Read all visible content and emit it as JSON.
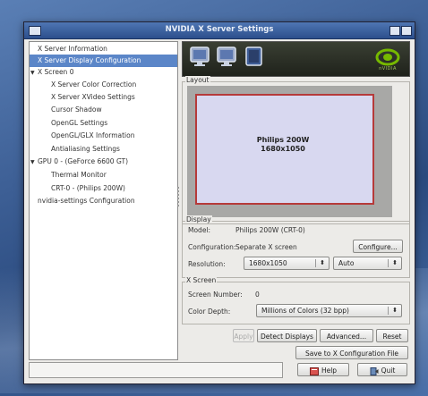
{
  "window": {
    "title": "NVIDIA X Server Settings"
  },
  "sidebar": {
    "items": [
      {
        "label": "X Server Information",
        "level": 1,
        "selected": false
      },
      {
        "label": "X Server Display Configuration",
        "level": 1,
        "selected": true
      },
      {
        "label": "X Screen 0",
        "level": 0,
        "expandable": true
      },
      {
        "label": "X Server Color Correction",
        "level": 2
      },
      {
        "label": "X Server XVideo Settings",
        "level": 2
      },
      {
        "label": "Cursor Shadow",
        "level": 2
      },
      {
        "label": "OpenGL Settings",
        "level": 2
      },
      {
        "label": "OpenGL/GLX Information",
        "level": 2
      },
      {
        "label": "Antialiasing Settings",
        "level": 2
      },
      {
        "label": "GPU 0 - (GeForce 6600 GT)",
        "level": 0,
        "expandable": true
      },
      {
        "label": "Thermal Monitor",
        "level": 2
      },
      {
        "label": "CRT-0 - (Philips 200W)",
        "level": 2
      },
      {
        "label": "nvidia-settings Configuration",
        "level": 1
      }
    ]
  },
  "banner": {
    "logo_text": "nVIDIA",
    "logo_color": "#76b900"
  },
  "layout": {
    "section_label": "Layout",
    "screen_title": "Philips 200W",
    "screen_resolution": "1680x1050"
  },
  "display": {
    "section_label": "Display",
    "model_label": "Model:",
    "model_value": "Philips 200W (CRT-0)",
    "configuration_label": "Configuration:",
    "configuration_value": "Separate X screen",
    "configure_button": "Configure...",
    "resolution_label": "Resolution:",
    "resolution_value": "1680x1050",
    "refresh_value": "Auto"
  },
  "xscreen": {
    "section_label": "X Screen",
    "screen_number_label": "Screen Number:",
    "screen_number_value": "0",
    "color_depth_label": "Color Depth:",
    "color_depth_value": "Millions of Colors (32 bpp)"
  },
  "actions": {
    "apply_button": "Apply",
    "detect_button": "Detect Displays",
    "advanced_button": "Advanced...",
    "reset_button": "Reset",
    "save_button": "Save to X Configuration File",
    "help_button": "Help",
    "quit_button": "Quit"
  },
  "statusbar": {
    "text": ""
  }
}
